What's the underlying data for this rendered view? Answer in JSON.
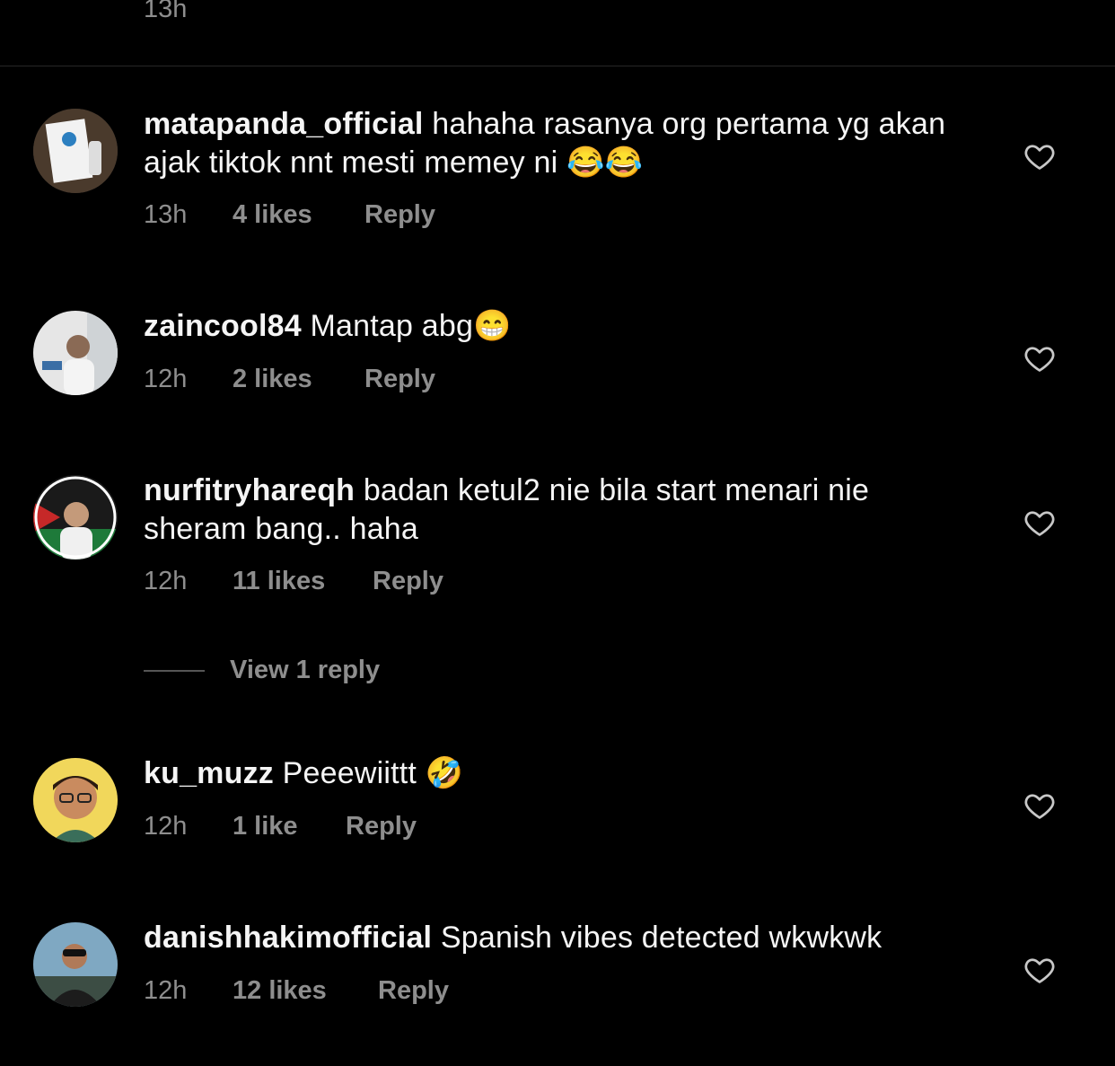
{
  "top_time": "13h",
  "comments": [
    {
      "username": "matapanda_official",
      "text": "hahaha rasanya org pertama yg akan ajak tiktok nnt mesti memey ni",
      "emoji": "😂😂",
      "time": "13h",
      "likes": "4 likes",
      "reply": "Reply"
    },
    {
      "username": "zaincool84",
      "text": "Mantap abg",
      "emoji": "😁",
      "time": "12h",
      "likes": "2 likes",
      "reply": "Reply"
    },
    {
      "username": "nurfitryhareqh",
      "text": "badan ketul2 nie bila start menari nie sheram bang.. haha",
      "emoji": "",
      "time": "12h",
      "likes": "11 likes",
      "reply": "Reply",
      "view_replies": "View 1 reply"
    },
    {
      "username": "ku_muzz",
      "text": "Peeewiittt",
      "emoji": "🤣",
      "time": "12h",
      "likes": "1 like",
      "reply": "Reply"
    },
    {
      "username": "danishhakimofficial",
      "text": "Spanish vibes detected wkwkwk",
      "emoji": "",
      "time": "12h",
      "likes": "12 likes",
      "reply": "Reply"
    }
  ],
  "icons": {
    "like": "heart-outline-icon"
  },
  "colors": {
    "background": "#000000",
    "text": "#f5f5f5",
    "secondary": "#8e8e8e"
  }
}
